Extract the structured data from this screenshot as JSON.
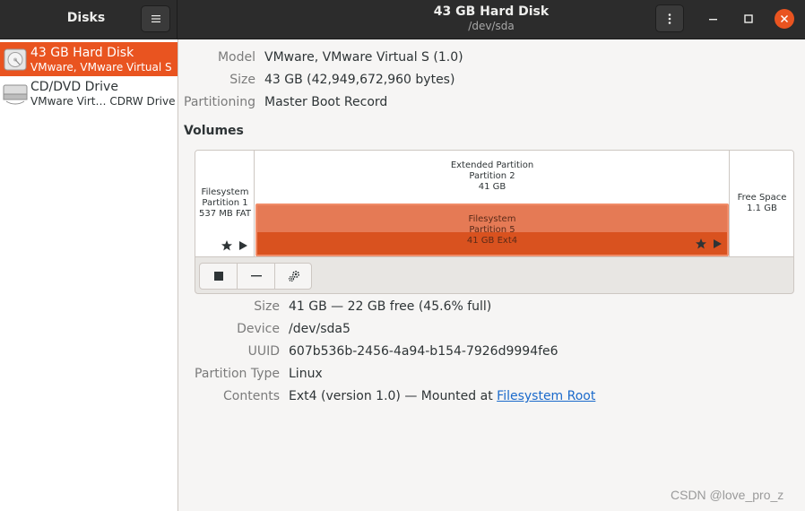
{
  "app": {
    "title": "Disks"
  },
  "window": {
    "title": "43 GB Hard Disk",
    "subtitle": "/dev/sda"
  },
  "icons": {
    "menu": "hamburger-menu-icon",
    "kebab": "vertical-dots-icon",
    "minimize": "minimize-icon",
    "maximize": "maximize-icon",
    "close": "close-icon"
  },
  "colors": {
    "accent": "#e95420",
    "partition_selected": "#e56b3f",
    "link": "#1b6acb"
  },
  "sidebar": {
    "items": [
      {
        "name": "43 GB Hard Disk",
        "description": "VMware, VMware Virtual S",
        "icon": "hard-disk-icon",
        "selected": true
      },
      {
        "name": "CD/DVD Drive",
        "description": "VMware Virt… CDRW Drive",
        "icon": "optical-drive-icon",
        "selected": false
      }
    ]
  },
  "disk": {
    "model_label": "Model",
    "model": "VMware, VMware Virtual S (1.0)",
    "size_label": "Size",
    "size": "43 GB (42,949,672,960 bytes)",
    "partitioning_label": "Partitioning",
    "partitioning": "Master Boot Record"
  },
  "volumes": {
    "title": "Volumes",
    "partition1": {
      "line1": "Filesystem",
      "line2": "Partition 1",
      "line3": "537 MB FAT"
    },
    "partition2": {
      "line1": "Extended Partition",
      "line2": "Partition 2",
      "line3": "41 GB"
    },
    "partition5": {
      "line1": "Filesystem",
      "line2": "Partition 5",
      "line3": "41 GB Ext4"
    },
    "free": {
      "line1": "Free Space",
      "line2": "1.1 GB"
    }
  },
  "toolbar": {
    "stop_icon": "stop-icon",
    "remove_icon": "minus-icon",
    "settings_icon": "gears-icon"
  },
  "selected_volume": {
    "size_label": "Size",
    "size": "41 GB — 22 GB free (45.6% full)",
    "device_label": "Device",
    "device": "/dev/sda5",
    "uuid_label": "UUID",
    "uuid": "607b536b-2456-4a94-b154-7926d9994fe6",
    "ptype_label": "Partition Type",
    "ptype": "Linux",
    "contents_label": "Contents",
    "contents_prefix": "Ext4 (version 1.0) — Mounted at ",
    "contents_link": "Filesystem Root"
  },
  "watermark": "CSDN @love_pro_z"
}
